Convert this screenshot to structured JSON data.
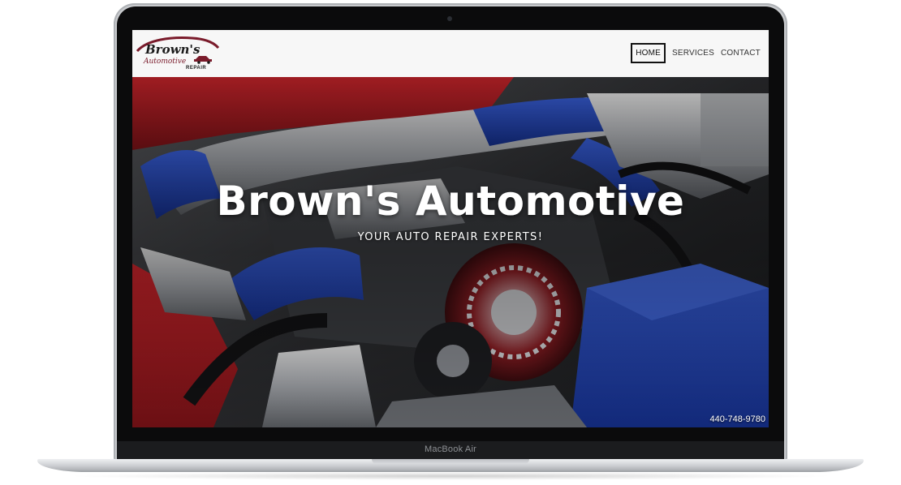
{
  "device": {
    "label": "MacBook Air"
  },
  "site": {
    "logo": {
      "line1": "Brown's",
      "line2": "Automotive",
      "line3": "REPAIR",
      "icon": "car-silhouette-icon"
    },
    "nav": {
      "items": [
        {
          "label": "HOME",
          "active": true
        },
        {
          "label": "SERVICES",
          "active": false
        },
        {
          "label": "CONTACT",
          "active": false
        }
      ]
    },
    "hero": {
      "title": "Brown's Automotive",
      "subtitle": "YOUR AUTO REPAIR EXPERTS!",
      "background": "engine-bay-photo",
      "phone": "440-748-9780"
    }
  },
  "colors": {
    "logo_red": "#7a1b2b",
    "hero_text": "#ffffff",
    "engine_red": "#b01d23",
    "engine_blue": "#1f3fb0"
  }
}
